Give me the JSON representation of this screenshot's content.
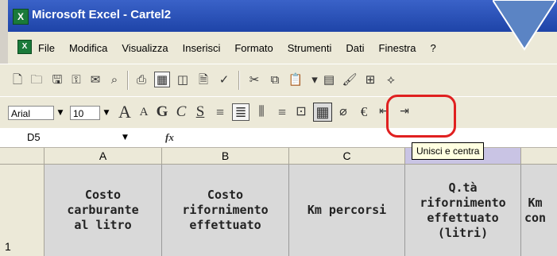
{
  "window": {
    "title": "Microsoft Excel - Cartel2"
  },
  "menu": {
    "items": [
      "File",
      "Modifica",
      "Visualizza",
      "Inserisci",
      "Formato",
      "Strumenti",
      "Dati",
      "Finestra",
      "?"
    ]
  },
  "toolbar_format": {
    "font_name": "Arial",
    "font_size": "10"
  },
  "formula_bar": {
    "name_box": "D5",
    "fx_label": "fx"
  },
  "tooltip": {
    "text": "Unisci e centra"
  },
  "columns": [
    "A",
    "B",
    "C",
    "D"
  ],
  "row": {
    "number": "1",
    "cells": [
      "Costo\ncarburante\nal litro",
      "Costo\nrifornimento\neffettuato",
      "Km percorsi",
      "Q.tà\nrifornimento\neffettuato\n(litri)",
      "Km\ncon"
    ]
  },
  "colors": {
    "title_bar": "#2a52be",
    "highlight_ring": "#e02020",
    "pointer_arrow": "#5b84c4",
    "header_cell_bg": "#d9d9d9"
  },
  "icons": {
    "app": "excel-icon",
    "highlighted": "merge-and-center-icon"
  }
}
